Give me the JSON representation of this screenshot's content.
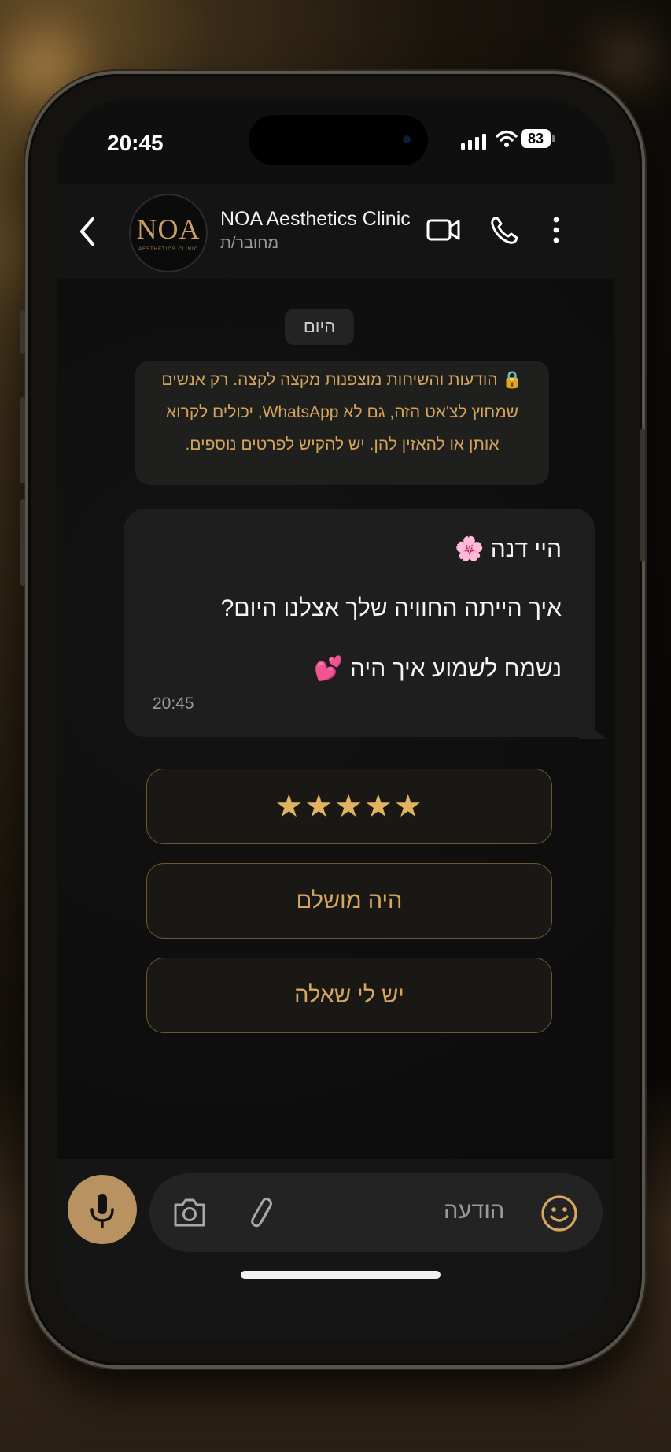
{
  "status_bar": {
    "time": "20:45",
    "battery": "83"
  },
  "header": {
    "avatar_logo": "NOA",
    "avatar_logo_sub": "AESTHETICS CLINIC",
    "contact_name": "NOA Aesthetics Clinic",
    "contact_status": "מחובר/ת"
  },
  "chat": {
    "date_chip": "היום",
    "encryption_notice": "🔒 הודעות והשיחות מוצפנות מקצה לקצה. רק אנשים שמחוץ לצ'אט הזה, גם לא WhatsApp, יכולים לקרוא אותן או להאזין להן. יש להקיש לפרטים נוספים.",
    "message": {
      "line1": "היי דנה 🌸",
      "line2": "איך הייתה החוויה שלך אצלנו היום?",
      "line3": "נשמח לשמוע איך היה 💕",
      "time": "20:45"
    },
    "quick_replies": [
      "★★★★★",
      "היה מושלם",
      "יש לי שאלה"
    ]
  },
  "input": {
    "placeholder": "הודעה"
  },
  "colors": {
    "accent_gold": "#d6a660",
    "mic_button": "#b89260",
    "bubble": "#1e1e1e"
  }
}
